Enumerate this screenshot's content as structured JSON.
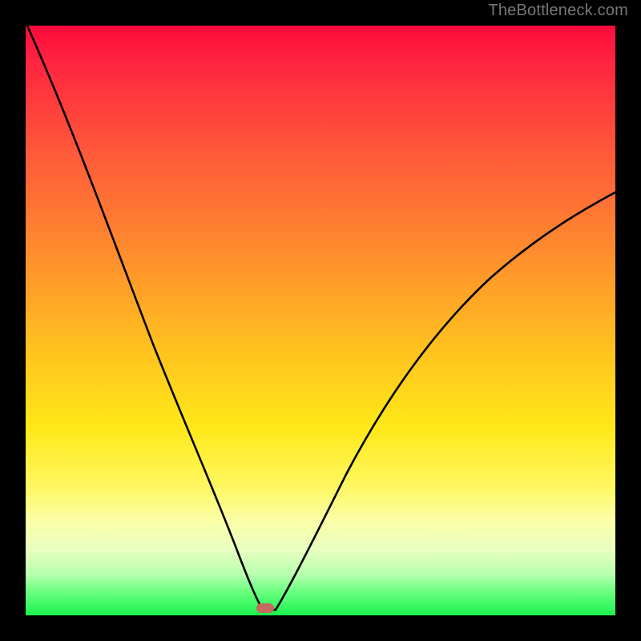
{
  "watermark": "TheBottleneck.com",
  "chart_data": {
    "type": "line",
    "title": "",
    "xlabel": "",
    "ylabel": "",
    "x_range": [
      0,
      100
    ],
    "y_range": [
      0,
      100
    ],
    "series": [
      {
        "name": "bottleneck-curve",
        "x": [
          0,
          5,
          10,
          15,
          20,
          25,
          30,
          35,
          38,
          40,
          41,
          45,
          50,
          55,
          60,
          65,
          70,
          75,
          80,
          85,
          90,
          95,
          100
        ],
        "y": [
          100,
          92,
          83,
          73,
          62,
          50,
          37,
          22,
          10,
          2,
          0,
          6,
          15,
          24,
          32,
          39,
          45,
          50,
          55,
          59,
          63,
          66,
          69
        ]
      }
    ],
    "minimum_point": {
      "x": 41,
      "y": 0
    },
    "marker": {
      "x": 41,
      "y": 0,
      "color": "#c66a5f"
    },
    "gradient_stops": [
      {
        "pos": 0,
        "color": "#ff0a3c"
      },
      {
        "pos": 22,
        "color": "#ff5a3a"
      },
      {
        "pos": 55,
        "color": "#ffc21f"
      },
      {
        "pos": 78,
        "color": "#fbffa8"
      },
      {
        "pos": 100,
        "color": "#19f24d"
      }
    ]
  }
}
